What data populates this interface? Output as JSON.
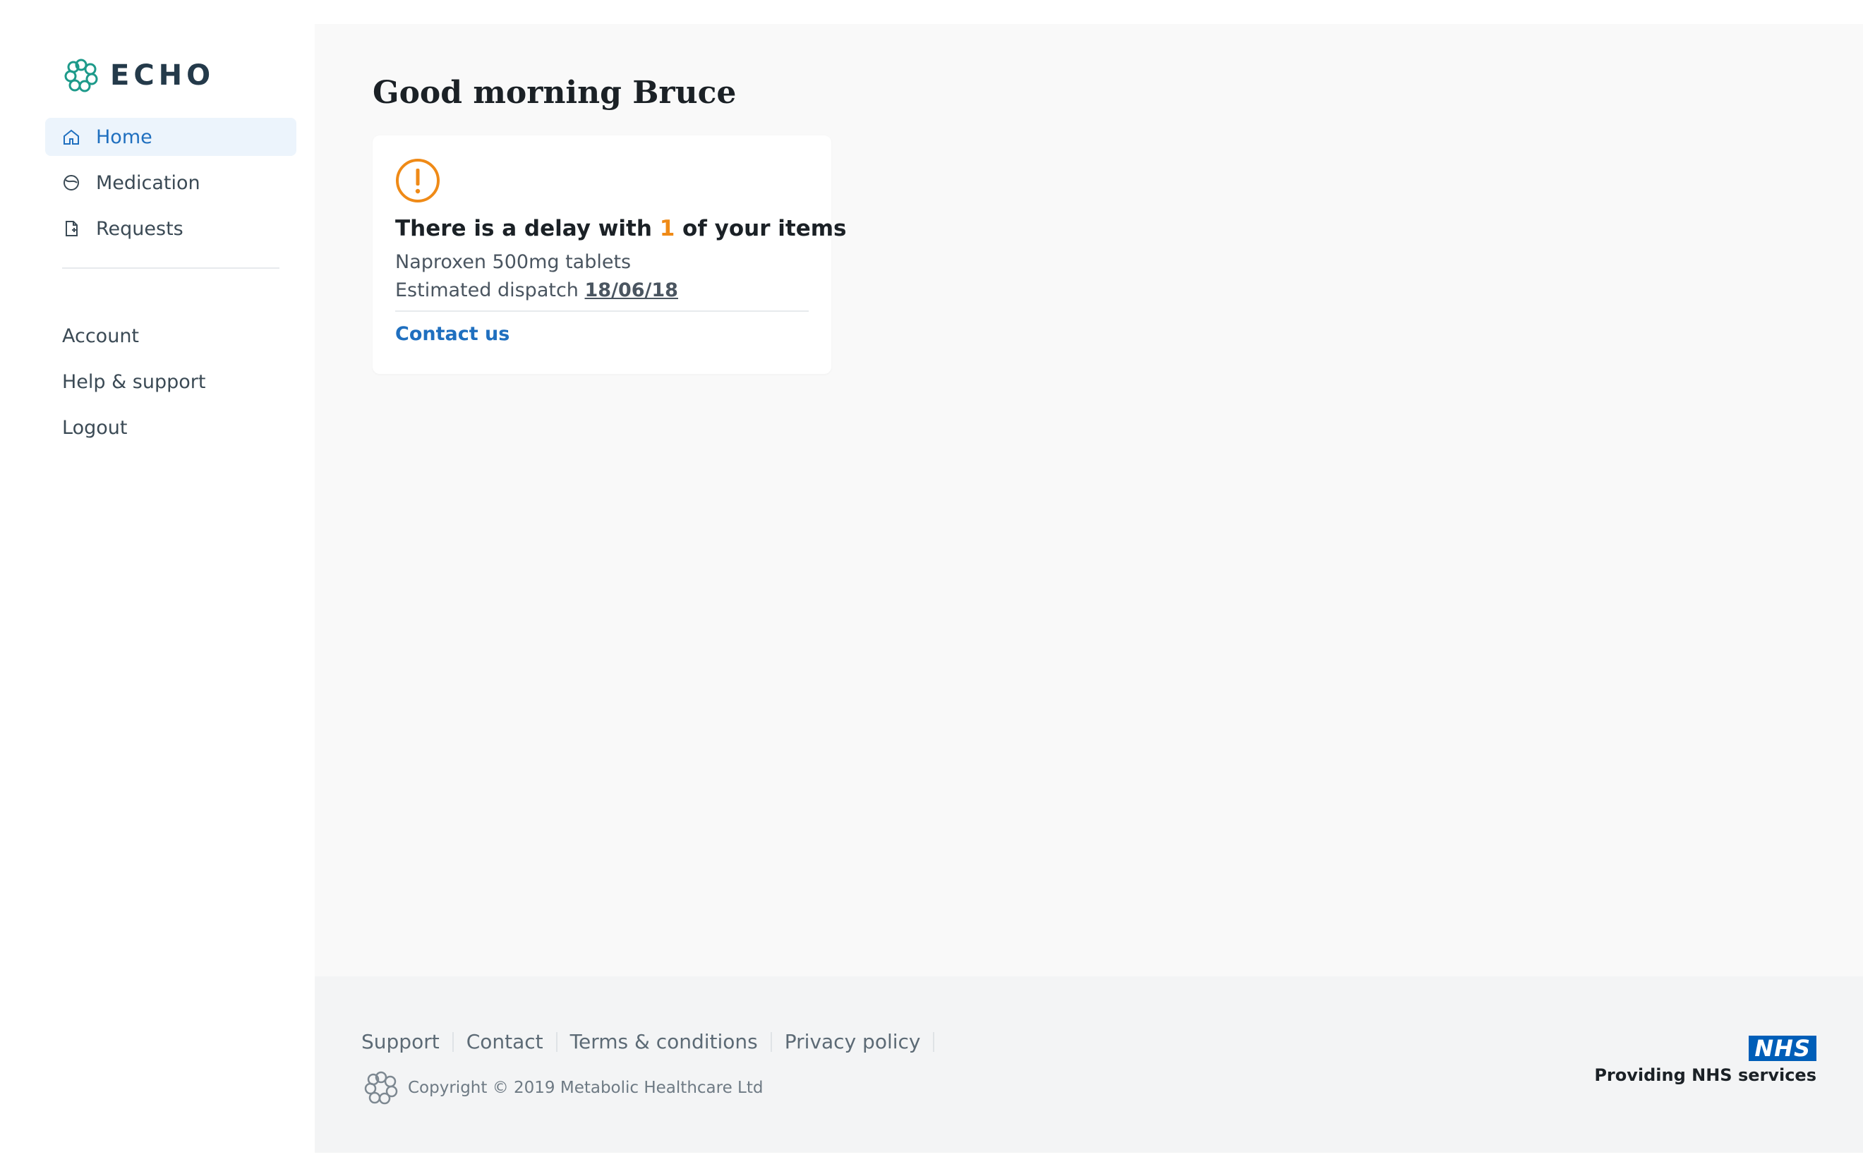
{
  "brand": {
    "name": "ECHO",
    "color": "#1d9a8a"
  },
  "sidebar": {
    "items": [
      {
        "label": "Home",
        "icon": "home-icon",
        "active": true
      },
      {
        "label": "Medication",
        "icon": "pill-icon"
      },
      {
        "label": "Requests",
        "icon": "document-icon"
      }
    ],
    "secondary": [
      {
        "label": "Account"
      },
      {
        "label": "Help & support"
      },
      {
        "label": "Logout"
      }
    ]
  },
  "main": {
    "greeting": "Good morning Bruce",
    "card": {
      "icon": "warning-icon",
      "title_prefix": "There is a delay with ",
      "count": "1",
      "title_suffix": " of your items",
      "item_name": "Naproxen 500mg tablets",
      "dispatch_label": "Estimated dispatch",
      "dispatch_date": "18/06/18",
      "contact_label": "Contact us"
    }
  },
  "footer": {
    "links": [
      "Support",
      "Contact",
      "Terms & conditions",
      "Privacy policy"
    ],
    "copyright": "Copyright © 2019 Metabolic Healthcare Ltd",
    "nhs_logo": "NHS",
    "nhs_text": "Providing NHS services"
  },
  "colors": {
    "accent": "#1f6fbf",
    "warning": "#ef8a17",
    "nhs_blue": "#005eb8"
  }
}
